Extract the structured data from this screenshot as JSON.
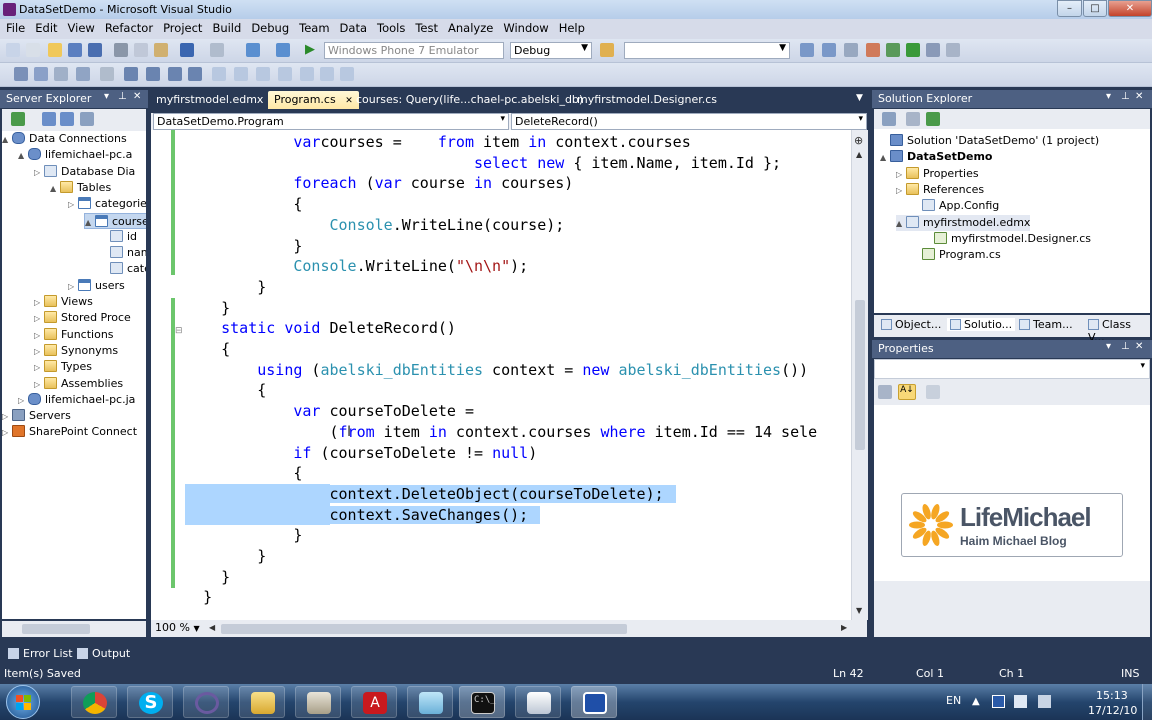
{
  "window": {
    "title": "DataSetDemo - Microsoft Visual Studio"
  },
  "menu": [
    "File",
    "Edit",
    "View",
    "Refactor",
    "Project",
    "Build",
    "Debug",
    "Team",
    "Data",
    "Tools",
    "Test",
    "Analyze",
    "Window",
    "Help"
  ],
  "toolbar": {
    "target": "Windows Phone 7 Emulator",
    "config": "Debug",
    "find": ""
  },
  "server_explorer": {
    "title": "Server Explorer",
    "items": [
      "Data Connections",
      "lifemichael-pc.a",
      "Database Dia",
      "Tables",
      "categorie",
      "courses",
      "id",
      "name",
      "categ",
      "users",
      "Views",
      "Stored Proce",
      "Functions",
      "Synonyms",
      "Types",
      "Assemblies",
      "lifemichael-pc.ja",
      "Servers",
      "SharePoint Connect"
    ]
  },
  "tabs": [
    "myfirstmodel.edmx",
    "Program.cs",
    "courses: Query(life...chael-pc.abelski_db)",
    "myfirstmodel.Designer.cs"
  ],
  "navbar": {
    "left": "DataSetDemo.Program",
    "right": "DeleteRecord()"
  },
  "code": [
    {
      "i": "            ",
      "parts": [
        [
          "kw",
          "var"
        ],
        [
          "",
          "courses = "
        ],
        [
          "",
          "   "
        ],
        [
          "kw",
          "from"
        ],
        [
          "",
          " item "
        ],
        [
          "kw",
          "in"
        ],
        [
          "",
          " context.courses"
        ]
      ]
    },
    {
      "i": "                                ",
      "parts": [
        [
          "kw",
          "select"
        ],
        [
          "",
          ""
        ],
        [
          "kw",
          " new"
        ],
        [
          "",
          " { item.Name, item.Id };"
        ]
      ]
    },
    {
      "i": "            ",
      "parts": [
        [
          "kw",
          "foreach"
        ],
        [
          "",
          " ("
        ],
        [
          "kw",
          "var"
        ],
        [
          "",
          " course "
        ],
        [
          "kw",
          "in"
        ],
        [
          "",
          " courses)"
        ]
      ]
    },
    {
      "i": "            ",
      "parts": [
        [
          "",
          "{"
        ]
      ]
    },
    {
      "i": "                ",
      "parts": [
        [
          "ty",
          "Console"
        ],
        [
          "",
          ".WriteLine(course);"
        ]
      ]
    },
    {
      "i": "            ",
      "parts": [
        [
          "",
          "}"
        ]
      ]
    },
    {
      "i": "            ",
      "parts": [
        [
          "ty",
          "Console"
        ],
        [
          "",
          ".WriteLine("
        ],
        [
          "st",
          "\"\\n\\n\""
        ],
        [
          "",
          ");"
        ]
      ]
    },
    {
      "i": "        ",
      "parts": [
        [
          "",
          "}"
        ]
      ]
    },
    {
      "i": "    ",
      "parts": [
        [
          "",
          "}"
        ]
      ]
    },
    {
      "i": "    ",
      "parts": [
        [
          "kw",
          "static"
        ],
        [
          "kw",
          " void"
        ],
        [
          "",
          " DeleteRecord()"
        ]
      ]
    },
    {
      "i": "    ",
      "parts": [
        [
          "",
          "{"
        ]
      ]
    },
    {
      "i": "        ",
      "parts": [
        [
          "kw",
          "using"
        ],
        [
          "",
          " ("
        ],
        [
          "ty",
          "abelski_dbEntities"
        ],
        [
          "",
          " context = "
        ],
        [
          "kw",
          "new"
        ],
        [
          "ty",
          " abelski_dbEntities"
        ],
        [
          "",
          "())"
        ]
      ]
    },
    {
      "i": "        ",
      "parts": [
        [
          "",
          "{"
        ]
      ]
    },
    {
      "i": "            ",
      "parts": [
        [
          "kw",
          "var"
        ],
        [
          "",
          " courseToDelete ="
        ]
      ]
    },
    {
      "i": "                ",
      "parts": [
        [
          "",
          "("
        ],
        [
          "kw",
          "from"
        ],
        [
          "",
          " item "
        ],
        [
          "kw",
          "in"
        ],
        [
          "",
          " context.courses "
        ],
        [
          "kw",
          "where"
        ],
        [
          "",
          " item.Id == 14 sele"
        ]
      ]
    },
    {
      "i": "            ",
      "parts": [
        [
          "kw",
          "if"
        ],
        [
          "",
          " (courseToDelete != "
        ],
        [
          "kw",
          "null"
        ],
        [
          "",
          ")"
        ]
      ]
    },
    {
      "i": "            ",
      "parts": [
        [
          "",
          "{"
        ]
      ]
    },
    {
      "i": "                ",
      "parts": [
        [
          "",
          "context.DeleteObject(courseToDelete);"
        ]
      ],
      "sel": true
    },
    {
      "i": "                ",
      "parts": [
        [
          "",
          "context.SaveChanges();"
        ]
      ],
      "sel": true
    },
    {
      "i": "            ",
      "parts": [
        [
          "",
          "}"
        ]
      ]
    },
    {
      "i": "        ",
      "parts": [
        [
          "",
          "}"
        ]
      ]
    },
    {
      "i": "    ",
      "parts": [
        [
          "",
          "}"
        ]
      ]
    },
    {
      "i": "  ",
      "parts": [
        [
          "",
          "}"
        ]
      ]
    }
  ],
  "zoom": "100 %",
  "solution_explorer": {
    "title": "Solution Explorer",
    "items": [
      "Solution 'DataSetDemo' (1 project)",
      "DataSetDemo",
      "Properties",
      "References",
      "App.Config",
      "myfirstmodel.edmx",
      "myfirstmodel.Designer.cs",
      "Program.cs"
    ],
    "tabs": [
      "Object...",
      "Solutio...",
      "Team...",
      "Class V..."
    ]
  },
  "properties": {
    "title": "Properties"
  },
  "logo": {
    "name": "LifeMichael",
    "sub": "Haim Michael Blog"
  },
  "bottom_tabs": [
    "Error List",
    "Output"
  ],
  "status": {
    "msg": "Item(s) Saved",
    "ln": "Ln 42",
    "col": "Col 1",
    "ch": "Ch 1",
    "mode": "INS"
  },
  "tray": {
    "lang": "EN",
    "time": "15:13",
    "date": "17/12/10"
  }
}
